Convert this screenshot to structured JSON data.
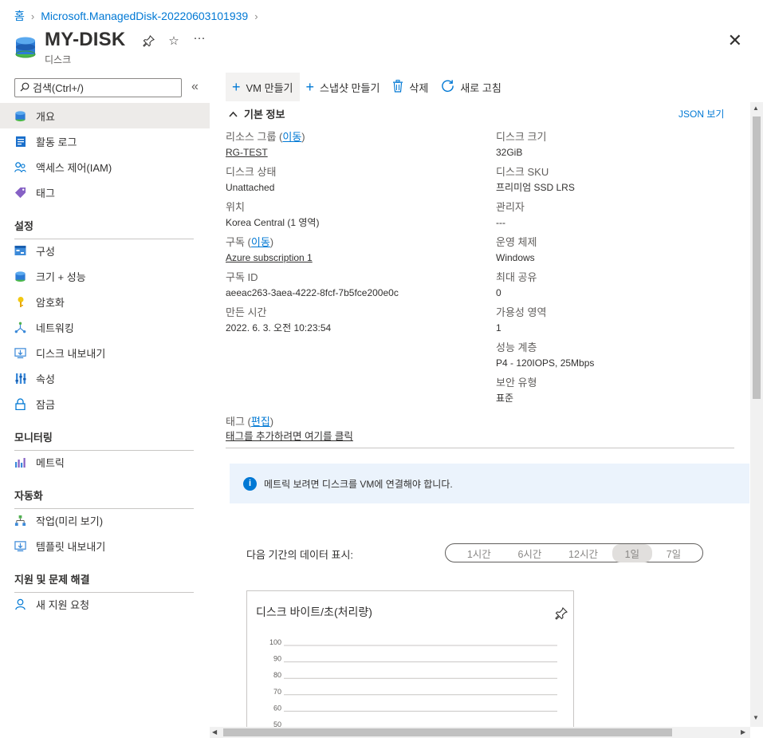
{
  "breadcrumb": {
    "home": "홈",
    "resource_group": "Microsoft.ManagedDisk-20220603101939"
  },
  "header": {
    "title": "MY-DISK",
    "subtitle": "디스크",
    "pin_icon": "pin-icon",
    "favorite_icon": "star-icon",
    "more_icon": "more-icon",
    "close_icon": "close-icon"
  },
  "sidebar": {
    "search_placeholder": "검색(Ctrl+/)",
    "collapse_icon": "double-chevron-left-icon",
    "items_top": [
      {
        "label": "개요",
        "icon": "disk-icon",
        "active": true
      },
      {
        "label": "활동 로그",
        "icon": "activity-log-icon"
      },
      {
        "label": "액세스 제어(IAM)",
        "icon": "iam-icon"
      },
      {
        "label": "태그",
        "icon": "tag-icon"
      }
    ],
    "sections": [
      {
        "title": "설정",
        "items": [
          {
            "label": "구성",
            "icon": "configuration-icon"
          },
          {
            "label": "크기 + 성능",
            "icon": "disk-icon"
          },
          {
            "label": "암호화",
            "icon": "key-icon"
          },
          {
            "label": "네트워킹",
            "icon": "network-icon"
          },
          {
            "label": "디스크 내보내기",
            "icon": "export-icon"
          },
          {
            "label": "속성",
            "icon": "properties-icon"
          },
          {
            "label": "잠금",
            "icon": "lock-icon"
          }
        ]
      },
      {
        "title": "모니터링",
        "items": [
          {
            "label": "메트릭",
            "icon": "metrics-icon"
          }
        ]
      },
      {
        "title": "자동화",
        "items": [
          {
            "label": "작업(미리 보기)",
            "icon": "tasks-icon"
          },
          {
            "label": "템플릿 내보내기",
            "icon": "export-template-icon"
          }
        ]
      },
      {
        "title": "지원 및 문제 해결",
        "items": [
          {
            "label": "새 지원 요청",
            "icon": "support-icon"
          }
        ]
      }
    ]
  },
  "toolbar": {
    "create_vm": "VM 만들기",
    "create_snapshot": "스냅샷 만들기",
    "delete": "삭제",
    "refresh": "새로 고침"
  },
  "essentials": {
    "heading": "기본 정보",
    "json_view": "JSON 보기",
    "left": [
      {
        "label": "리소스 그룹",
        "move": "이동",
        "value": "RG-TEST",
        "link": true
      },
      {
        "label": "디스크 상태",
        "value": "Unattached"
      },
      {
        "label": "위치",
        "value": "Korea Central (1 영역)"
      },
      {
        "label": "구독",
        "move": "이동",
        "value": "Azure subscription 1",
        "link": true
      },
      {
        "label": "구독 ID",
        "value": "aeeac263-3aea-4222-8fcf-7b5fce200e0c"
      },
      {
        "label": "만든 시간",
        "value": "2022. 6. 3. 오전 10:23:54"
      }
    ],
    "right": [
      {
        "label": "디스크 크기",
        "value": "32GiB"
      },
      {
        "label": "디스크 SKU",
        "value": "프리미엄 SSD LRS"
      },
      {
        "label": "관리자",
        "value": "---"
      },
      {
        "label": "운영 체제",
        "value": "Windows"
      },
      {
        "label": "최대 공유",
        "value": "0"
      },
      {
        "label": "가용성 영역",
        "value": "1"
      },
      {
        "label": "성능 계층",
        "value": "P4 - 120IOPS, 25Mbps"
      },
      {
        "label": "보안 유형",
        "value": "표준"
      }
    ],
    "tags_label": "태그",
    "tags_edit": "편집",
    "tags_add": "태그를 추가하려면 여기를 클릭"
  },
  "info_message": "메트릭 보려면 디스크를 VM에 연결해야 합니다.",
  "time_range": {
    "label": "다음 기간의 데이터 표시:",
    "options": [
      "1시간",
      "6시간",
      "12시간",
      "1일",
      "7일"
    ],
    "selected": "1일"
  },
  "chart_data": {
    "type": "line",
    "title": "디스크 바이트/초(처리량)",
    "y_ticks": [
      "100",
      "90",
      "80",
      "70",
      "60",
      "50"
    ],
    "series": []
  }
}
